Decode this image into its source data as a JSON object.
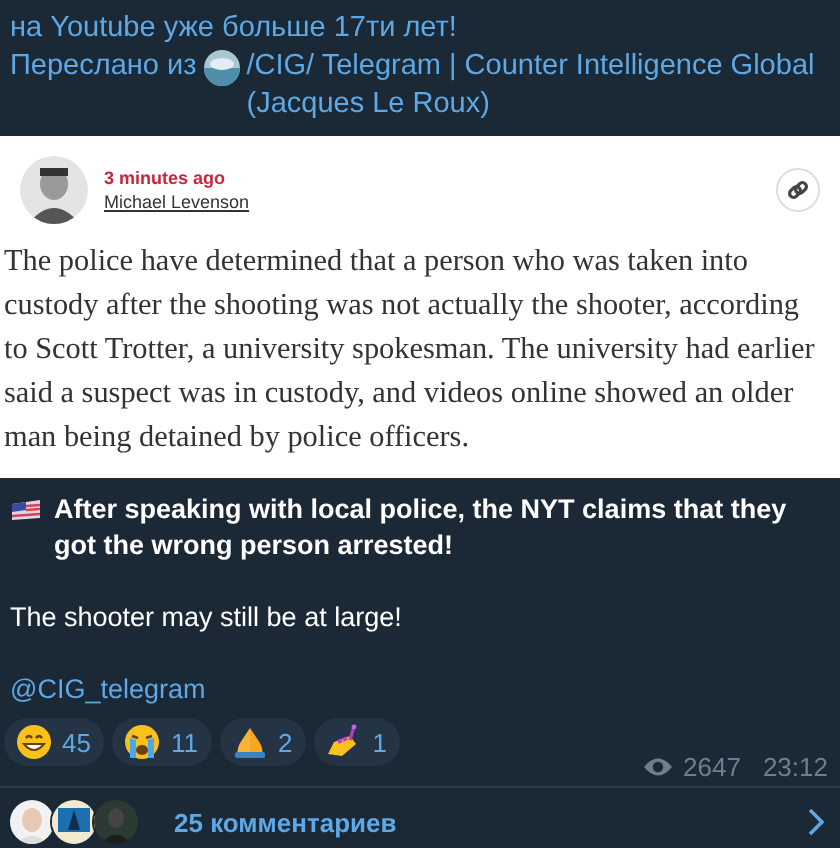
{
  "header": {
    "lines": [
      "на Youtube уже больше 17ти лет!"
    ],
    "forwarded_label": "Переслано из",
    "forwarded_source": "/CIG/ Telegram | Counter Intelligence Global (Jacques Le Roux)"
  },
  "article": {
    "time": "3 minutes ago",
    "author": "Michael Levenson",
    "body": "The police have determined that a person who was taken into custody after the shooting was not actually the shooter, according to Scott Trotter, a university spokesman. The university had earlier said a suspect was in custody, and videos online showed an older man being detained by police officers."
  },
  "message": {
    "headline": "After speaking with local police, the NYT claims that they got the wrong person arrested!",
    "paragraph": "The shooter may still be at large!",
    "mention": "@CIG_telegram"
  },
  "reactions": [
    {
      "kind": "grin",
      "count": "45"
    },
    {
      "kind": "cry",
      "count": "11"
    },
    {
      "kind": "pray",
      "count": "2"
    },
    {
      "kind": "nails",
      "count": "1"
    }
  ],
  "views": "2647",
  "time": "23:12",
  "comments": {
    "label": "25 комментариев"
  }
}
